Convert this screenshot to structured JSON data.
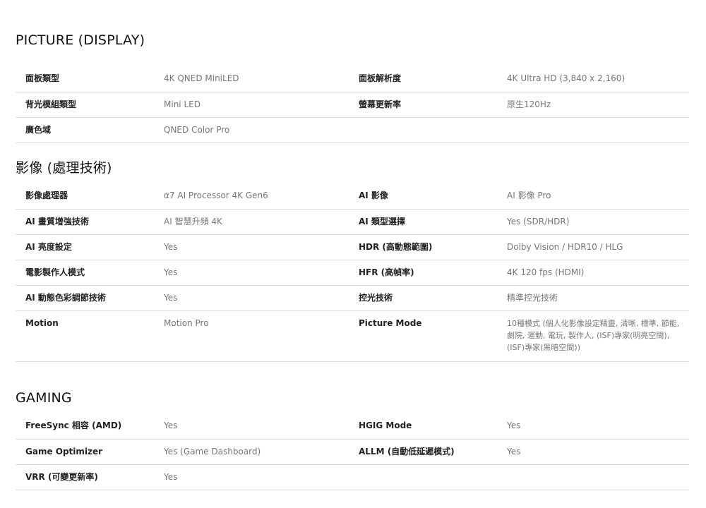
{
  "sections": [
    {
      "title": "PICTURE (DISPLAY)",
      "rows": [
        {
          "k1": "面板類型",
          "v1": "4K QNED MiniLED",
          "k2": "面板解析度",
          "v2": "4K Ultra HD (3,840 x 2,160)"
        },
        {
          "k1": "背光模組類型",
          "v1": "Mini LED",
          "k2": "螢幕更新率",
          "v2": "原生120Hz"
        },
        {
          "k1": "廣色域",
          "v1": "QNED Color Pro",
          "k2": "",
          "v2": ""
        }
      ]
    },
    {
      "title": "影像 (處理技術)",
      "rows": [
        {
          "k1": "影像處理器",
          "v1": "α7 AI Processor 4K Gen6",
          "k2": "AI 影像",
          "v2": "AI 影像 Pro"
        },
        {
          "k1": "AI 畫質增強技術",
          "v1": "AI 智慧升頻 4K",
          "k2": "AI 類型選擇",
          "v2": "Yes (SDR/HDR)"
        },
        {
          "k1": "AI 亮度設定",
          "v1": "Yes",
          "k2": "HDR (高動態範圍)",
          "v2": "Dolby Vision / HDR10 / HLG"
        },
        {
          "k1": "電影製作人模式",
          "v1": "Yes",
          "k2": "HFR (高幀率)",
          "v2": "4K 120 fps (HDMI)"
        },
        {
          "k1": "AI 動態色彩調節技術",
          "v1": "Yes",
          "k2": "控光技術",
          "v2": "精準控光技術"
        },
        {
          "k1": "Motion",
          "v1": "Motion Pro",
          "k2": "Picture Mode",
          "v2": "10種模式 (個人化影像設定精靈, 清晰, 標準, 節能, 劇院, 運動, 電玩, 製作人, (ISF)專家(明亮空間), (ISF)專家(黑暗空間))"
        }
      ]
    },
    {
      "title": "GAMING",
      "rows": [
        {
          "k1": "FreeSync 相容 (AMD)",
          "v1": "Yes",
          "k2": "HGIG Mode",
          "v2": "Yes"
        },
        {
          "k1": "Game Optimizer",
          "v1": "Yes (Game Dashboard)",
          "k2": "ALLM (自動低延遲模式)",
          "v2": "Yes"
        },
        {
          "k1": "VRR (可變更新率)",
          "v1": "Yes",
          "k2": "",
          "v2": ""
        }
      ]
    }
  ]
}
